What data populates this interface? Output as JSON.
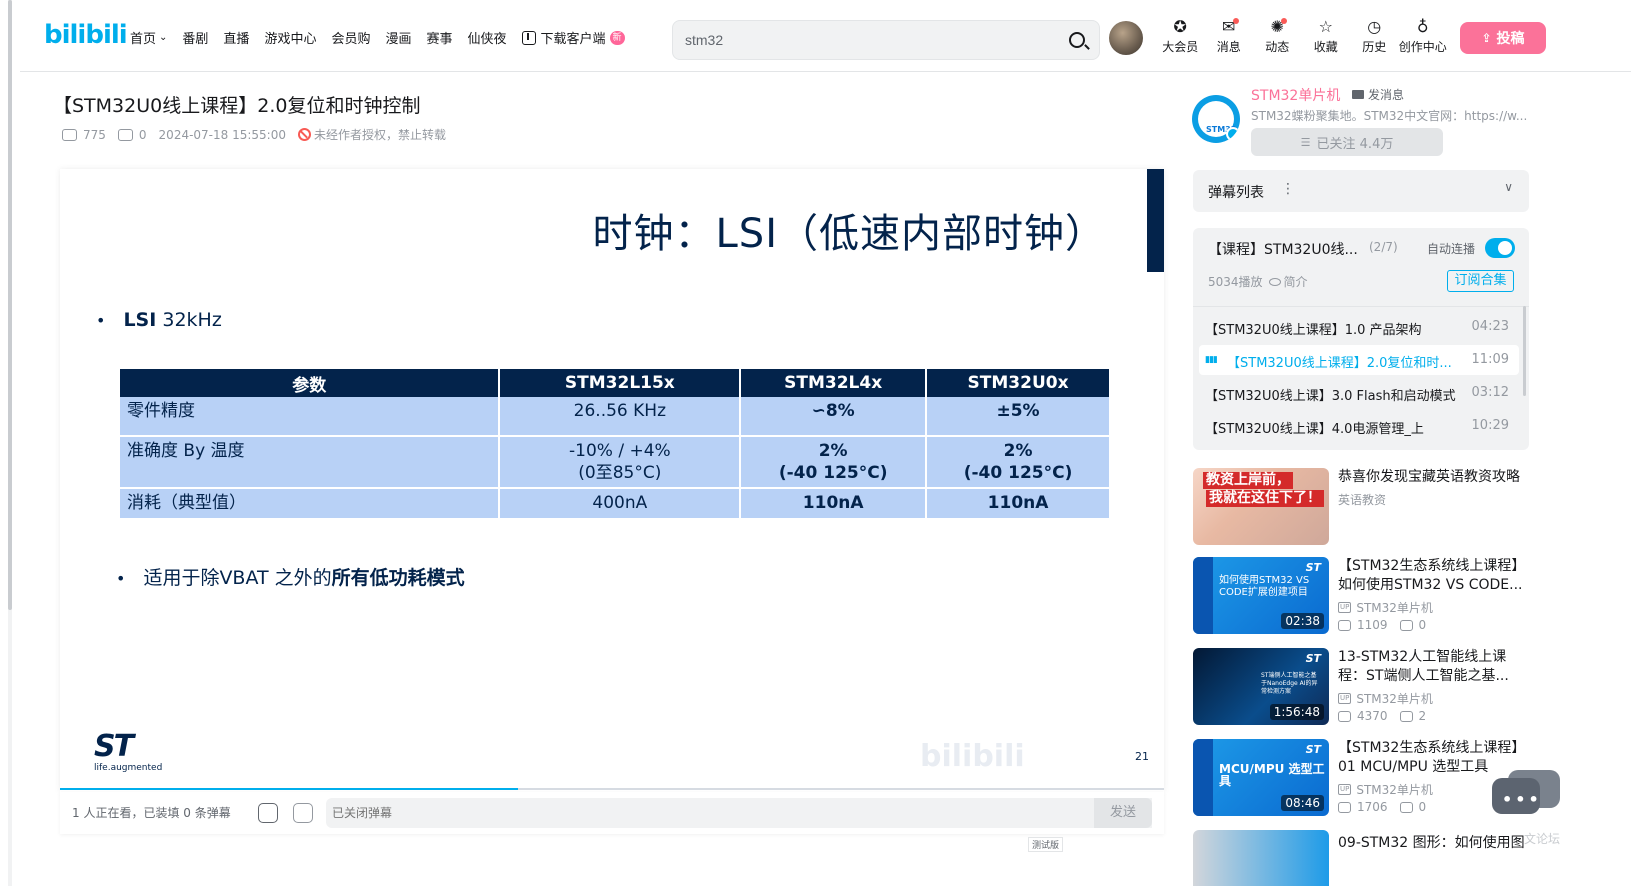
{
  "header": {
    "logo": "bilibili",
    "nav": [
      {
        "label": "首页",
        "has_chevron": true
      },
      {
        "label": "番剧"
      },
      {
        "label": "直播"
      },
      {
        "label": "游戏中心"
      },
      {
        "label": "会员购"
      },
      {
        "label": "漫画"
      },
      {
        "label": "赛事"
      },
      {
        "label": "仙侠夜"
      }
    ],
    "download": {
      "label": "下载客户端",
      "badge": "新"
    },
    "search": {
      "value": "stm32"
    },
    "right_nav": [
      {
        "label": "大会员",
        "icon": "vip-icon",
        "glyph": "✪"
      },
      {
        "label": "消息",
        "icon": "message-icon",
        "glyph": "✉",
        "dot": true
      },
      {
        "label": "动态",
        "icon": "dynamic-icon",
        "glyph": "✺",
        "dot": true
      },
      {
        "label": "收藏",
        "icon": "star-icon",
        "glyph": "☆"
      },
      {
        "label": "历史",
        "icon": "clock-icon",
        "glyph": "◷"
      },
      {
        "label": "创作中心",
        "icon": "bulb-icon",
        "glyph": "♁"
      }
    ],
    "upload_label": "投稿"
  },
  "video": {
    "title": "【STM32U0线上课程】2.0复位和时钟控制",
    "plays": "775",
    "danmaku": "0",
    "date": "2024-07-18 15:55:00",
    "copyright": "未经作者授权，禁止转载",
    "progress_fraction": 0.415
  },
  "slide": {
    "title": "时钟：LSI（低速内部时钟）",
    "bullet1_bold": "LSI",
    "bullet1_rest": " 32kHz",
    "table_headers": [
      "参数",
      "STM32L15x",
      "STM32L4x",
      "STM32U0x"
    ],
    "rows": [
      {
        "label": "零件精度",
        "c1": "26..56 KHz",
        "c2": "∽8%",
        "c3": "±5%"
      },
      {
        "label": "准确度 By 温度",
        "c1": "-10% / +4%",
        "c1b": "(0至85°C)",
        "c2": "2%",
        "c2b": "(-40 125°C)",
        "c3": "2%",
        "c3b": "(-40 125°C)"
      },
      {
        "label": "消耗（典型值）",
        "c1": "400nA",
        "c2": "110nA",
        "c3": "110nA"
      }
    ],
    "bullet2_rest": "适用于除VBAT 之外的",
    "bullet2_bold": "所有低功耗模式",
    "logo_text": "ST",
    "logo_tag": "life.augmented",
    "page": "21"
  },
  "danmaku_bar": {
    "watching": "1 人正在看，已装填 0 条弹幕",
    "input_placeholder": "已关闭弹幕",
    "send": "发送",
    "trial": "测试版"
  },
  "uploader": {
    "name": "STM32单片机",
    "message": "发消息",
    "description": "STM32蝶粉聚集地。STM32中文官网：https://w...",
    "follow": "已关注 4.4万",
    "avatar_text": "STM32"
  },
  "danmaku_list": {
    "title": "弹幕列表"
  },
  "playlist": {
    "title": "【课程】STM32U0线...",
    "count": "(2/7)",
    "autoplay": "自动连播",
    "plays": "5034播放",
    "intro": "简介",
    "subscribe": "订阅合集",
    "episodes": [
      {
        "title": "【STM32U0线上课程】1.0 产品架构",
        "duration": "04:23",
        "active": false
      },
      {
        "title": "【STM32U0线上课程】2.0复位和时...",
        "duration": "11:09",
        "active": true
      },
      {
        "title": "【STM32U0线上课】3.0 Flash和启动模式",
        "duration": "03:12",
        "active": false
      },
      {
        "title": "【STM32U0线上课】4.0电源管理_上",
        "duration": "10:29",
        "active": false
      }
    ]
  },
  "recommendations": [
    {
      "title": "恭喜你发现宝藏英语教资攻略",
      "author": "英语教资",
      "thumb_text1": "教资上岸前，",
      "thumb_text2": "我就在这住下了！"
    },
    {
      "title": "【STM32生态系统线上课程】如何使用STM32 VS CODE...",
      "author": "STM32单片机",
      "plays": "1109",
      "danmaku": "0",
      "duration": "02:38",
      "thumb_text": "如何使用STM32 VS CODE扩展创建项目"
    },
    {
      "title": "13-STM32人工智能线上课程：ST端侧人工智能之基...",
      "author": "STM32单片机",
      "plays": "4370",
      "danmaku": "2",
      "duration": "1:56:48",
      "thumb_text": "ST端侧人工智能之基于NanoEdge AI的异常检测方案"
    },
    {
      "title": "【STM32生态系统线上课程】01 MCU/MPU 选型工具",
      "author": "STM32单片机",
      "plays": "1706",
      "danmaku": "0",
      "duration": "08:46",
      "thumb_text": "MCU/MPU 选型工具"
    }
  ],
  "rec5": {
    "title": "09-STM32 图形：如何使用图"
  },
  "chat_float": {
    "label": "文论坛"
  }
}
